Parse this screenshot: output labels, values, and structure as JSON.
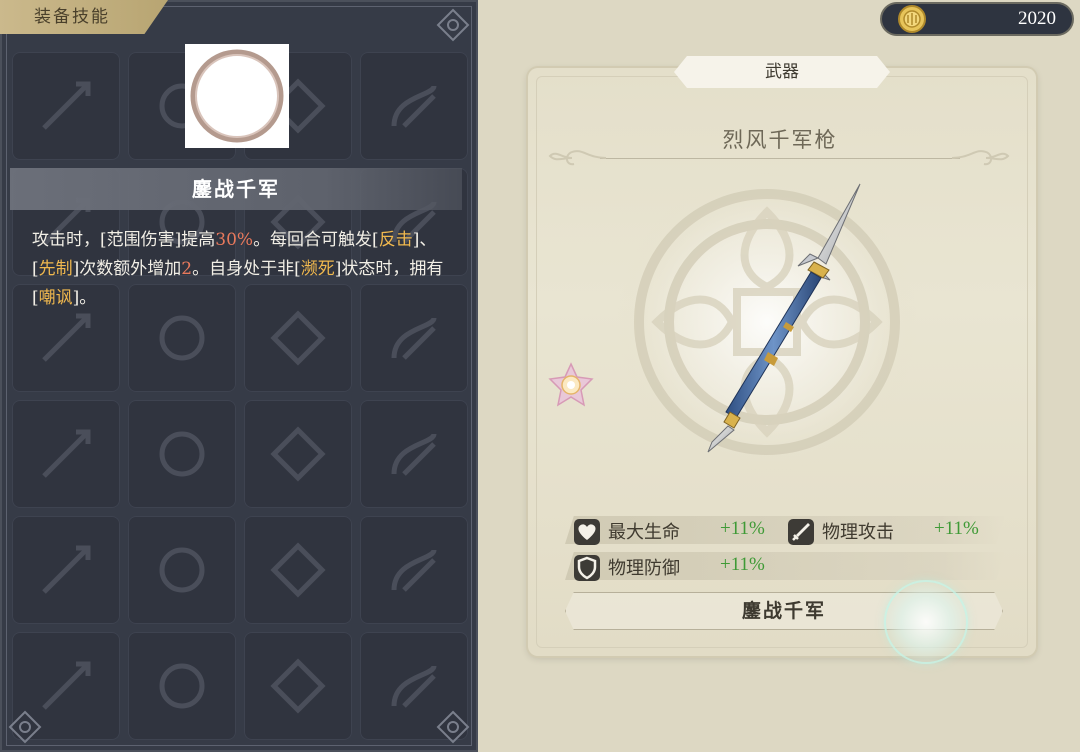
{
  "left_panel": {
    "tab_label": "装备技能",
    "skill_name": "鏖战千军",
    "description": {
      "p1": "攻击时，[范围伤害]提高",
      "p2": "30%",
      "p3": "。每回合可触发[",
      "p4": "反击",
      "p5": "]、[",
      "p6": "先制",
      "p7": "]次数额外增加",
      "p8": "2",
      "p9": "。自身处于非[",
      "p10": "濒死",
      "p11": "]状态时，拥有[",
      "p12": "嘲讽",
      "p13": "]。"
    }
  },
  "currency": {
    "value": "2020",
    "icon": "gold-coin-icon"
  },
  "weapon": {
    "category_tab": "武器",
    "name": "烈风千军枪",
    "stats": [
      {
        "icon": "heart-icon",
        "label": "最大生命",
        "value": "+11%"
      },
      {
        "icon": "sword-icon",
        "label": "物理攻击",
        "value": "+11%"
      },
      {
        "icon": "shield-icon",
        "label": "物理防御",
        "value": "+11%"
      }
    ],
    "skill_button": "鏖战千军"
  },
  "colors": {
    "panel_bg": "#363b47",
    "card_bg": "#e4dfca",
    "highlight_number": "#e8795c",
    "highlight_term": "#f0b84e",
    "stat_value": "#3f9a36"
  }
}
